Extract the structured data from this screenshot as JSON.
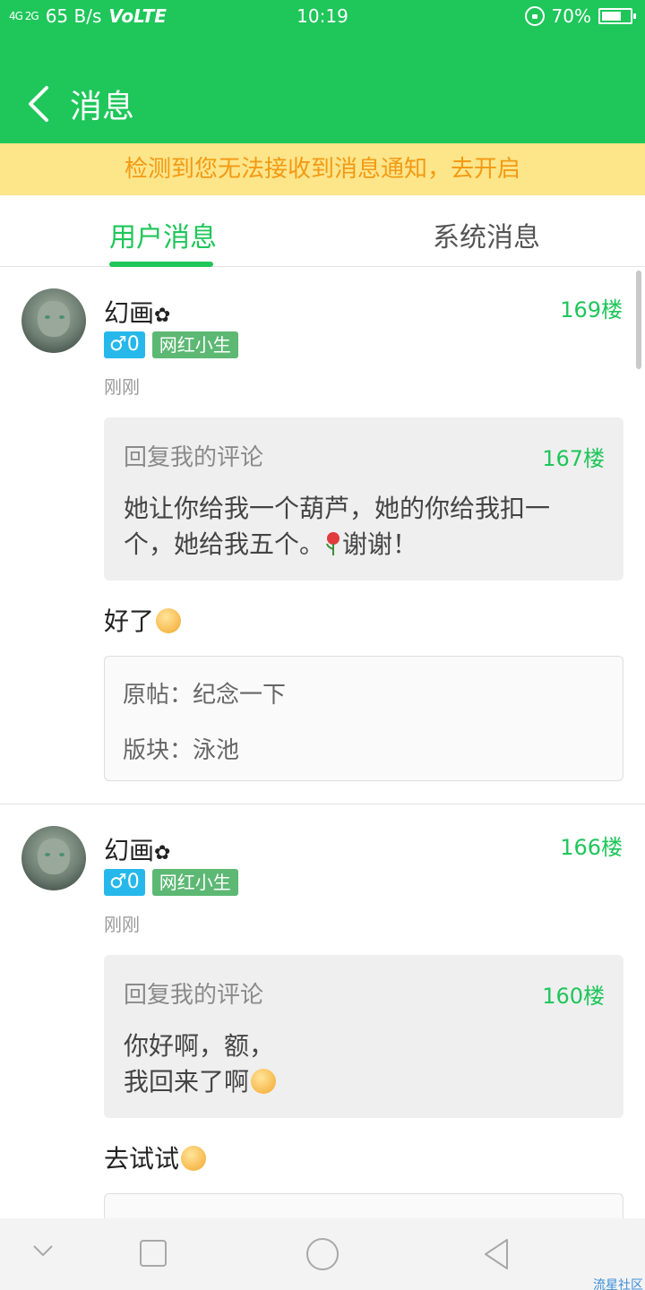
{
  "status_bar": {
    "signal_text": "4G 2G",
    "net_speed": "65 B/s",
    "volte": "VoLTE",
    "time": "10:19",
    "battery": "70%",
    "battery_level": 0.7
  },
  "header": {
    "title": "消息",
    "back_icon": "chevron-left-icon"
  },
  "notice": {
    "text": "检测到您无法接收到消息通知，去开启"
  },
  "tabs": [
    {
      "label": "用户消息",
      "active": true
    },
    {
      "label": "系统消息",
      "active": false
    }
  ],
  "messages": [
    {
      "username": "幻画",
      "username_icon": "flower-icon",
      "floor": "169楼",
      "gender_badge": "♂0",
      "title_badge": "网红小生",
      "time": "刚刚",
      "quote_label": "回复我的评论",
      "quote_floor": "167楼",
      "quote_text": "她让你给我一个葫芦，她的你给我扣一\n个，她给我五个。",
      "quote_text_after": "谢谢！",
      "reply_text": "好了",
      "origin_post": "原帖：纪念一下",
      "origin_board": "版块：泳池"
    },
    {
      "username": "幻画",
      "username_icon": "flower-icon",
      "floor": "166楼",
      "gender_badge": "♂0",
      "title_badge": "网红小生",
      "time": "刚刚",
      "quote_label": "回复我的评论",
      "quote_floor": "160楼",
      "quote_text": "你好啊，额，\n我回来了啊",
      "reply_text": "去试试"
    }
  ],
  "watermark": "流星社区",
  "colors": {
    "primary": "#1fc65a",
    "notice_bg": "#fde58a",
    "notice_text": "#f39a14",
    "gender_badge": "#26b8ea",
    "title_badge": "#5db874"
  }
}
